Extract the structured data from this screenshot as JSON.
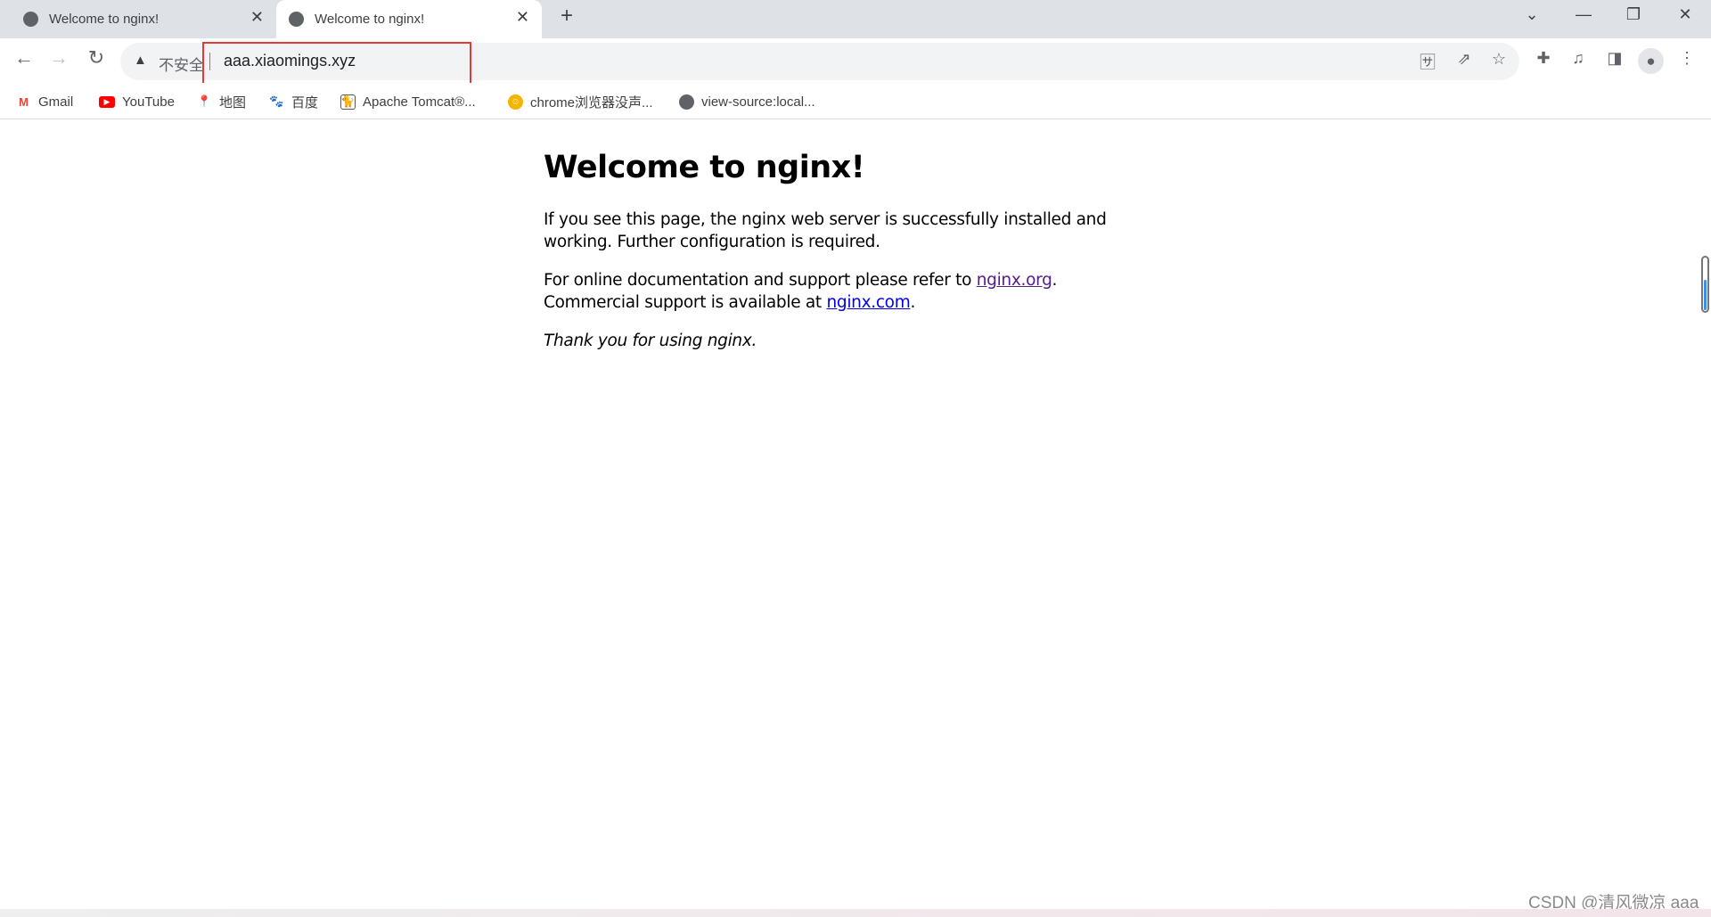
{
  "tabs": [
    {
      "title": "Welcome to nginx!",
      "active": false
    },
    {
      "title": "Welcome to nginx!",
      "active": true
    }
  ],
  "window_controls": {
    "tab_search": "⌄",
    "minimize": "—",
    "restore": "❐",
    "close": "✕"
  },
  "toolbar": {
    "security_label": "不安全",
    "url": "aaa.xiaomings.xyz"
  },
  "bookmarks": [
    {
      "label": "Gmail",
      "icon": "gmail-icon",
      "color": "#ea4335"
    },
    {
      "label": "YouTube",
      "icon": "youtube-icon",
      "color": "#ff0000"
    },
    {
      "label": "地图",
      "icon": "maps-icon",
      "color": "#34a853"
    },
    {
      "label": "百度",
      "icon": "baidu-icon",
      "color": "#2932e1"
    },
    {
      "label": "Apache Tomcat®...",
      "icon": "tomcat-icon",
      "color": "#a07b3a"
    },
    {
      "label": "chrome浏览器没声...",
      "icon": "chrome-help-icon",
      "color": "#f4b400"
    },
    {
      "label": "view-source:local...",
      "icon": "globe-icon",
      "color": "#5f6368"
    }
  ],
  "page": {
    "heading": "Welcome to nginx!",
    "p1_line1": "If you see this page, the nginx web server is successfully installed and",
    "p1_line2": "working. Further configuration is required.",
    "p2_pre": "For online documentation and support please refer to ",
    "p2_link": "nginx.org",
    "p2_post": ".",
    "p3_pre": "Commercial support is available at ",
    "p3_link": "nginx.com",
    "p3_post": ".",
    "thanks": "Thank you for using nginx.",
    "visited_link_color": "#551a8b",
    "link_color": "#0000ee"
  },
  "watermark": "CSDN @清风微凉 aaa"
}
